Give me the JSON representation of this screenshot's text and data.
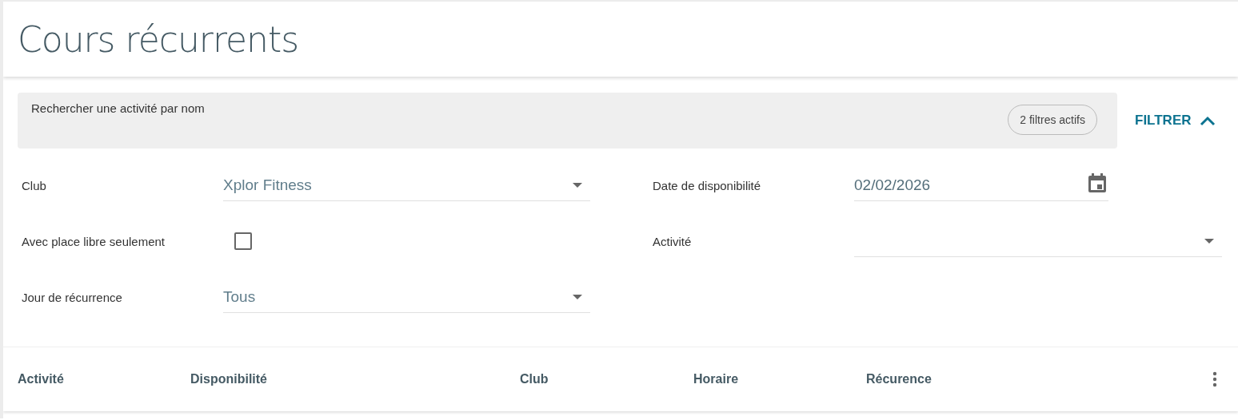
{
  "page": {
    "title": "Cours récurrents"
  },
  "search": {
    "placeholder": "Rechercher une activité par nom",
    "badge": "2 filtres actifs"
  },
  "filter_button": {
    "label": "FILTRER",
    "expanded": true
  },
  "filters": {
    "left": [
      {
        "kind": "select",
        "label": "Club",
        "value": "Xplor Fitness"
      },
      {
        "kind": "checkbox",
        "label": "Avec place libre seulement",
        "checked": false
      },
      {
        "kind": "select",
        "label": "Jour de récurrence",
        "value": "Tous"
      }
    ],
    "right": [
      {
        "kind": "date",
        "label": "Date de disponibilité",
        "value": "02/02/2026"
      },
      {
        "kind": "select",
        "label": "Activité"
      }
    ]
  },
  "table": {
    "columns": [
      "Activité",
      "Disponibilité",
      "Club",
      "Horaire",
      "Récurence"
    ]
  }
}
